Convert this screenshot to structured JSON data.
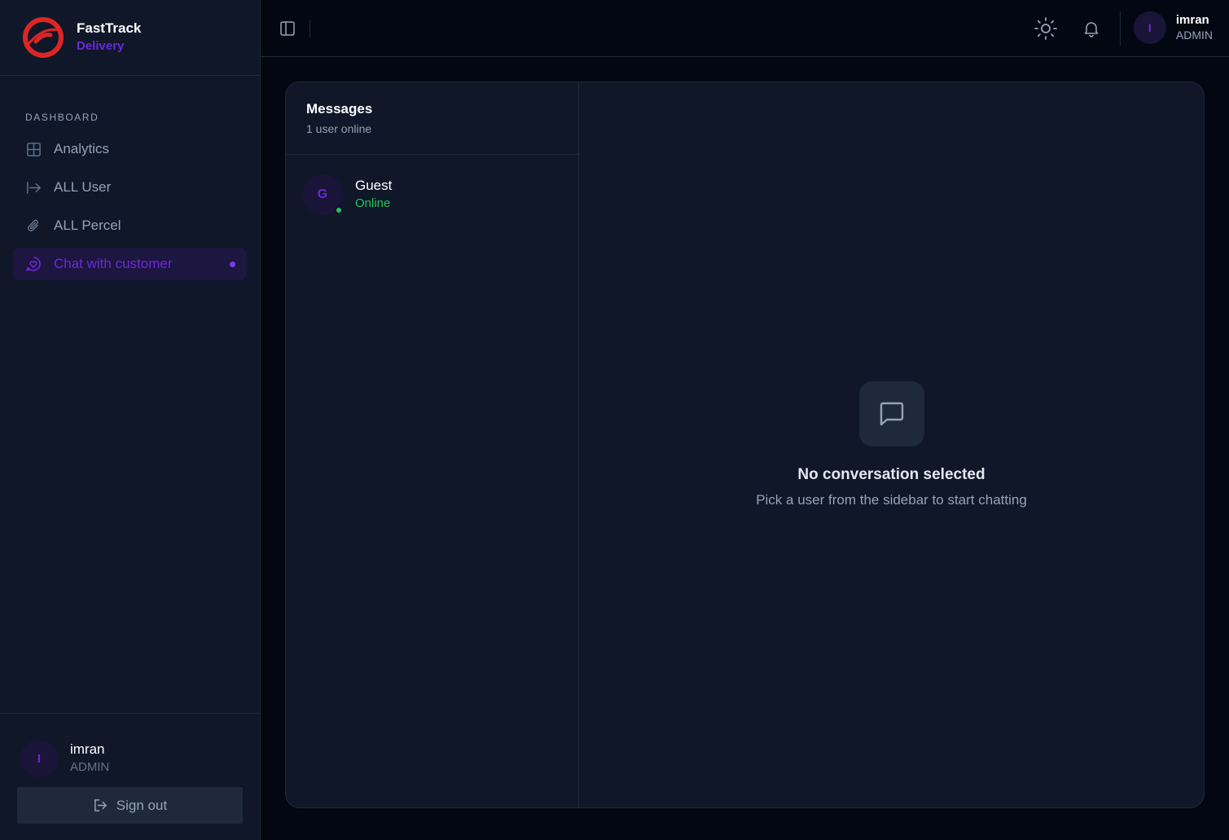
{
  "brand": {
    "name": "FastTrack",
    "subtitle": "Delivery"
  },
  "sidebar": {
    "section_heading": "DASHBOARD",
    "items": [
      {
        "label": "Analytics",
        "icon": "grid-icon"
      },
      {
        "label": "ALL User",
        "icon": "arrow-right-to-bar-icon"
      },
      {
        "label": "ALL Percel",
        "icon": "paperclip-icon"
      },
      {
        "label": "Chat with customer",
        "icon": "chat-heart-icon",
        "active": true
      }
    ],
    "footer_user": {
      "initial": "I",
      "name": "imran",
      "role": "ADMIN"
    },
    "signout_label": "Sign out"
  },
  "topbar": {
    "user": {
      "initial": "I",
      "name": "imran",
      "role": "ADMIN"
    }
  },
  "messages": {
    "title": "Messages",
    "online_count": "1 user online",
    "conversations": [
      {
        "initial": "G",
        "name": "Guest",
        "status": "Online"
      }
    ]
  },
  "empty_state": {
    "title": "No conversation selected",
    "subtitle": "Pick a user from the sidebar to start chatting"
  },
  "colors": {
    "accent": "#6d28d9",
    "online": "#22c55e",
    "brand_red": "#dc2626"
  }
}
